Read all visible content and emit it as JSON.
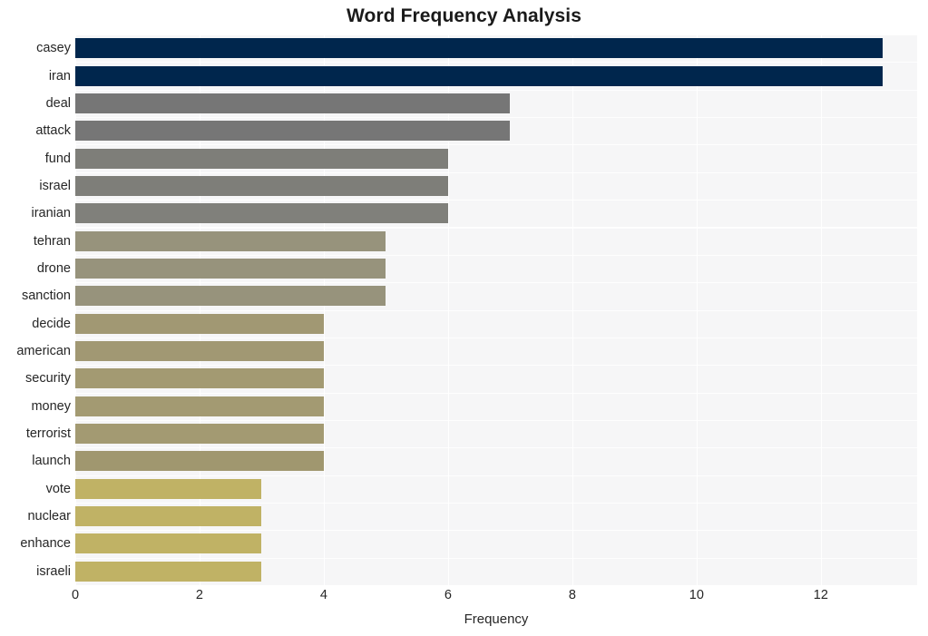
{
  "chart_data": {
    "type": "bar",
    "orientation": "horizontal",
    "title": "Word Frequency Analysis",
    "xlabel": "Frequency",
    "ylabel": "",
    "xlim": [
      0,
      13.55
    ],
    "xticks": [
      0,
      2,
      4,
      6,
      8,
      10,
      12
    ],
    "xtick_labels": [
      "0",
      "2",
      "4",
      "6",
      "8",
      "10",
      "12"
    ],
    "grid": true,
    "legend": "none",
    "categories": [
      "casey",
      "iran",
      "deal",
      "attack",
      "fund",
      "israel",
      "iranian",
      "tehran",
      "drone",
      "sanction",
      "decide",
      "american",
      "security",
      "money",
      "terrorist",
      "launch",
      "vote",
      "nuclear",
      "enhance",
      "israeli"
    ],
    "values": [
      13,
      13,
      7,
      7,
      6,
      6,
      6,
      5,
      5,
      5,
      4,
      4,
      4,
      4,
      4,
      4,
      3,
      3,
      3,
      3
    ],
    "bar_colors": [
      "#00264d",
      "#00264d",
      "#767676",
      "#767676",
      "#7e7e79",
      "#7e7e79",
      "#80807b",
      "#97937c",
      "#97937c",
      "#97937c",
      "#a19873",
      "#a19873",
      "#a39a72",
      "#a39a72",
      "#a39a72",
      "#a0976f",
      "#c0b265",
      "#c0b265",
      "#c0b265",
      "#c0b265"
    ],
    "colors": {
      "plot_background": "#f6f6f7",
      "figure_background": "#ffffff",
      "gridline": "#ffffff",
      "text": "#262626",
      "title": "#1a1a1a"
    }
  }
}
